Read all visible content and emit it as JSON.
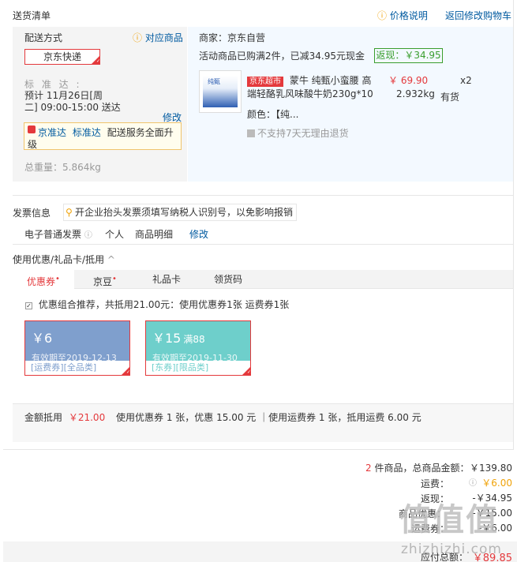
{
  "header": {
    "title": "送货清单",
    "price_note": "价格说明",
    "back_cart": "返回修改购物车"
  },
  "shipping": {
    "label": "配送方式",
    "match_goods": "对应商品",
    "express": "京东快递",
    "standard_label": "标 准 达 :",
    "eta_line1": "预计 11月26日[周",
    "eta_line2": "二] 09:00-15:00 送达",
    "modify": "修改",
    "jzd_brand": "京准达",
    "jzd_std": "标准达",
    "jzd_text1": "配送服务全面升",
    "jzd_text2": "级",
    "weight": "总重量：5.864kg"
  },
  "goods": {
    "merchant": "商家：京东自营",
    "promo": "活动商品已购满2件，已减34.95元现金",
    "rebate": "返现：￥34.95",
    "img_label": "纯甄",
    "tag": "京东超市",
    "name_line1": "蒙牛 纯甄小蛮腰 高",
    "name_line2": "端轻酪乳风味酸牛奶230g*10",
    "price": "￥ 69.90",
    "qty": "x2",
    "weight": "2.932kg",
    "stock": "有货",
    "color": "颜色：【纯...",
    "no_return": "不支持7天无理由退货"
  },
  "invoice": {
    "label": "发票信息",
    "tip": "开企业抬头发票须填写纳税人识别号，以免影响报销",
    "type": "电子普通发票",
    "personal": "个人",
    "detail": "商品明细",
    "modify": "修改"
  },
  "coupon": {
    "title": "使用优惠/礼品卡/抵用",
    "tabs": [
      "优惠券",
      "京豆",
      "礼品卡",
      "领货码"
    ],
    "recommend": "优惠组合推荐，共抵用21.00元：使用优惠券1张 运费券1张",
    "cards": [
      {
        "amount": "￥6",
        "cond": "",
        "expire": "有效期至2019-12-13",
        "tags": "[运费券][全品类]",
        "color": "#7f9fcd"
      },
      {
        "amount": "￥15",
        "cond": "满88",
        "expire": "有效期至2019-11-30",
        "tags": "[东券][限品类]",
        "color": "#6ecfcb"
      }
    ],
    "summary_label": "金额抵用",
    "summary_amount": "￥21.00",
    "summary_text": "使用优惠券 1 张，优惠 15.00 元 ｜使用运费券 1 张，抵用运费 6.00 元"
  },
  "totals": {
    "count": "2",
    "count_label": "件商品，总商品金额：",
    "goods_amount": "￥139.80",
    "freight_label": "运费：",
    "freight": "￥6.00",
    "cashback_label": "返现：",
    "cashback": "-￥34.95",
    "coupon_label": "商品优惠：",
    "coupon": "-￥15.00",
    "freight_coupon_label": "运费券：",
    "freight_coupon": "-￥6.00",
    "grand_label": "应付总额：",
    "grand": "￥89.85"
  },
  "watermark": {
    "text": "值值值",
    "url": "zhizhizhi.com"
  }
}
